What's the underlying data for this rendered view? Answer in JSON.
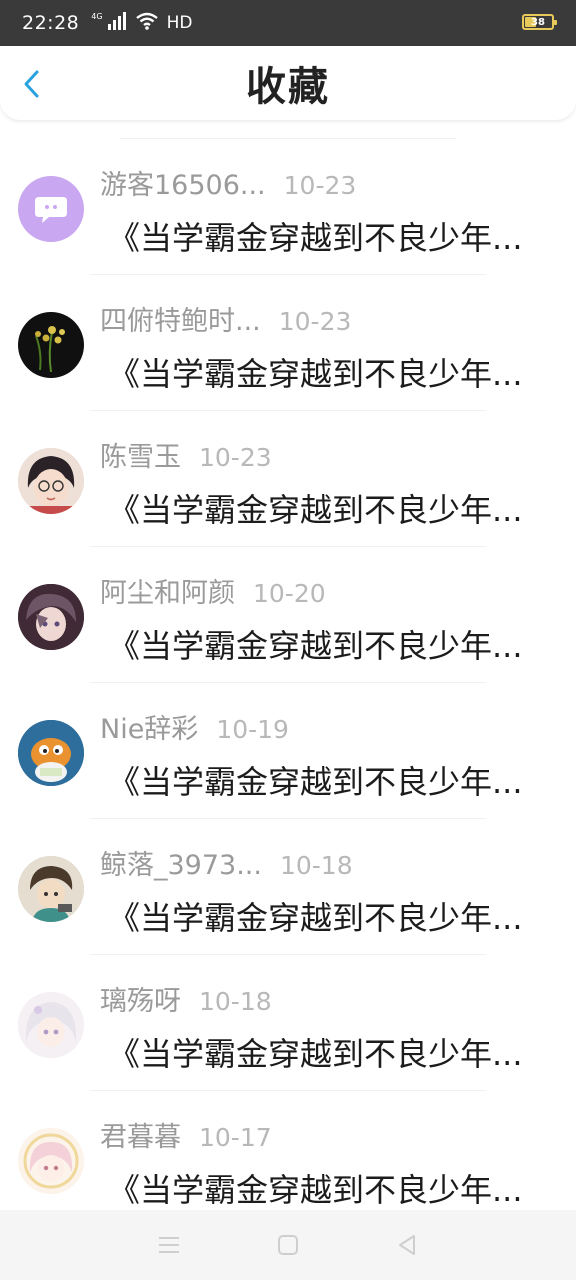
{
  "status_bar": {
    "time": "22:28",
    "network": "4G",
    "hd": "HD",
    "battery": "38"
  },
  "header": {
    "title": "收藏",
    "back_icon": "chevron-left-icon",
    "accent_color": "#2aa2e0"
  },
  "items": [
    {
      "name": "游客16506...",
      "date": "10-23",
      "title": "《当学霸金穿越到不良少年..."
    },
    {
      "name": "四俯特鲍时...",
      "date": "10-23",
      "title": "《当学霸金穿越到不良少年..."
    },
    {
      "name": "陈雪玉",
      "date": "10-23",
      "title": "《当学霸金穿越到不良少年..."
    },
    {
      "name": "阿尘和阿颜",
      "date": "10-20",
      "title": "《当学霸金穿越到不良少年..."
    },
    {
      "name": "Nie辞彩",
      "date": "10-19",
      "title": "《当学霸金穿越到不良少年..."
    },
    {
      "name": "鲸落_3973...",
      "date": "10-18",
      "title": "《当学霸金穿越到不良少年..."
    },
    {
      "name": "璃殇呀",
      "date": "10-18",
      "title": "《当学霸金穿越到不良少年..."
    },
    {
      "name": "君暮暮",
      "date": "10-17",
      "title": "《当学霸金穿越到不良少年..."
    }
  ],
  "nav_bar": {
    "menu_icon": "menu-icon",
    "home_icon": "home-square-icon",
    "back_icon": "back-triangle-icon"
  }
}
